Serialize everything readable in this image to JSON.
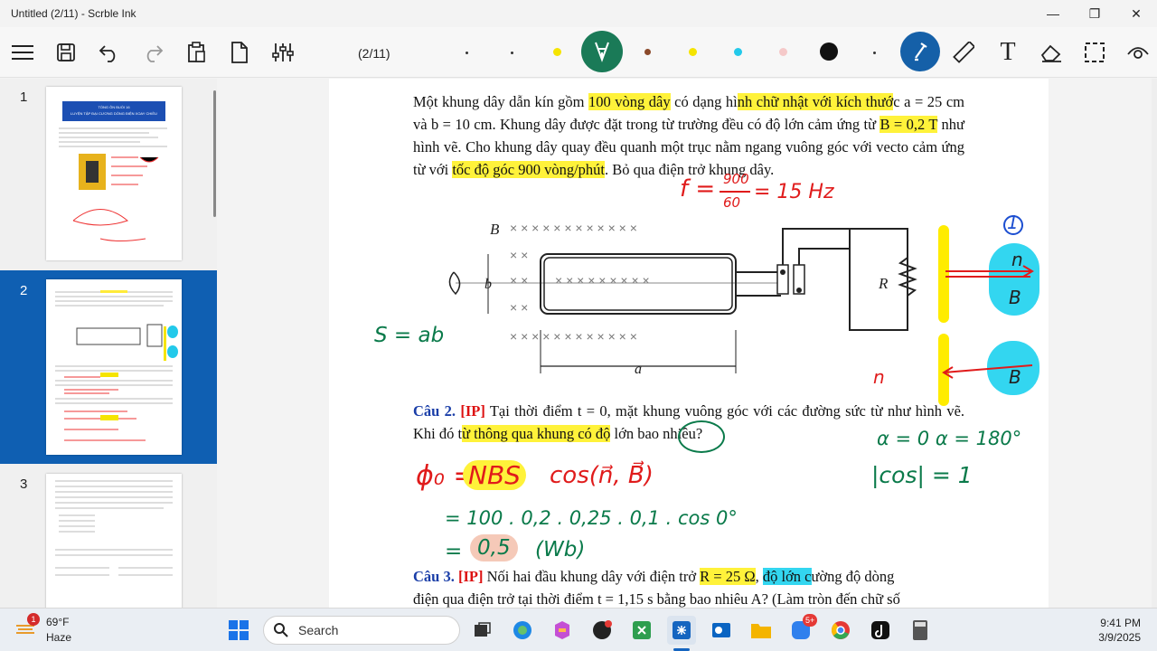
{
  "window": {
    "title": "Untitled (2/11) - Scrble Ink"
  },
  "toolbar": {
    "page_indicator": "(2/11)",
    "colors": {
      "yellow": "#f5e400",
      "brown": "#8b4a2b",
      "cyan": "#23c9ea",
      "peach": "#f5c9c9",
      "black": "#111111",
      "pen_bg": "#1a7a57",
      "active_bg": "#1560a8"
    }
  },
  "sidebar": {
    "items": [
      {
        "num": "1"
      },
      {
        "num": "2"
      },
      {
        "num": "3"
      }
    ],
    "thumb1_title": "TỔNG ÔN BUỔI 16",
    "thumb1_subtitle": "LUYỆN TẬP ĐẠI CƯƠNG DÒNG ĐIỆN XOAY CHIỀU"
  },
  "doc": {
    "para1_a": "Một khung dây dẫn kín gồm ",
    "para1_hl1": "100 vòng dây",
    "para1_b": " có dạng hì",
    "para1_hl2": "nh chữ nhật với kích thướ",
    "para1_c": "c a = 25 cm và b = 10 cm. Khung dây được đặt trong từ trường đều có độ lớn cảm ứng từ ",
    "para1_hl3": "B = 0,2 T",
    "para1_d": " như hình vẽ. Cho khung dây quay đều quanh một trục nằm ngang vuông góc với vecto cảm ứng từ với ",
    "para1_hl4": "tốc độ góc 900 vòng/phút",
    "para1_e": ". Bỏ qua điện trở khung dây.",
    "q2_num": "Câu 2.",
    "q2_tag": "[IP]",
    "q2_a": " Tại thời điểm t = 0, mặt khung vuông góc với các đường sức từ như hình vẽ. Khi đó t",
    "q2_hl": "ừ thông qua khung có độ",
    "q2_b": " lớn bao nhiêu?",
    "q3_num": "Câu 3.",
    "q3_tag": "[IP]",
    "q3_a": " Nối hai đầu khung dây với điện trở ",
    "q3_hl1": "R = 25 Ω",
    "q3_b": ", ",
    "q3_hl2": "độ lớn c",
    "q3_c": "ường độ dòng",
    "q3_line2": "điện qua điện trở tại thời điểm t = 1,15 s bằng bao nhiêu A? (Làm tròn đến chữ số"
  },
  "figure": {
    "B": "B",
    "b": "b",
    "a": "a",
    "R": "R"
  },
  "ink": {
    "freq": "f = 900/60 = 15 Hz",
    "freq_num": "900",
    "freq_den": "60",
    "freq_res": "= 15 Hz",
    "freq_f": "f =",
    "area": "S = ab",
    "one": "1",
    "n": "n",
    "Bv": "B",
    "alpha": "α = 0    α = 180°",
    "cos1": "|cos| = 1",
    "phi0": "ϕ₀ =",
    "nbs": "NBS",
    "cosnb": "cos(n⃗, B⃗)",
    "calc": "= 100 . 0,2 . 0,25 . 0,1 . cos 0°",
    "res": "0,5",
    "unit": "(Wb)",
    "eq": "="
  },
  "taskbar": {
    "weather_temp": "69°F",
    "weather_desc": "Haze",
    "search_placeholder": "Search",
    "time": "9:41 PM",
    "date": "3/9/2025",
    "badge_weather": "1",
    "badge_zalo": "5+"
  }
}
